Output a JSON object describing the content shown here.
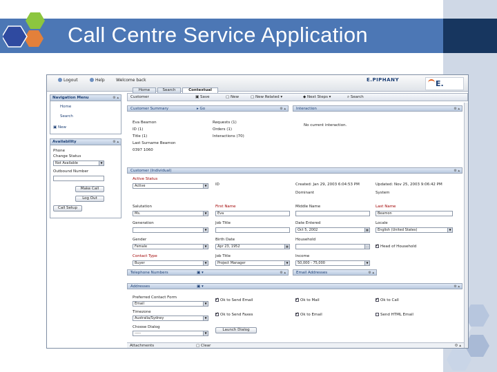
{
  "slide": {
    "title": "Call Centre Service Application",
    "colors": {
      "title_bar": "#4c77b5",
      "title_dark": "#17365f",
      "right_band": "#cfd8e6"
    }
  },
  "app": {
    "topbar": {
      "logout": "Logout",
      "help": "Help",
      "welcome": "Welcome back",
      "brand": "E.PIPHANY",
      "brand_logo": "E."
    },
    "tabs": [
      "Home",
      "Search",
      "Contextual"
    ],
    "nav_panel": {
      "title": "Navigation Menu",
      "items": [
        "Home",
        "Search"
      ],
      "new_label": "New"
    },
    "availability": {
      "title": "Availability",
      "phone_label": "Phone",
      "change_status_label": "Change Status",
      "status_value": "Not Available",
      "outbound_label": "Outbound Number",
      "make_call": "Make Call",
      "log_out": "Log Out",
      "call_setup": "Call Setup"
    },
    "toolbar": {
      "customer": "Customer",
      "save": "Save",
      "new": "New",
      "new_related": "New Related",
      "next_steps": "Next Steps",
      "search": "Search"
    },
    "summary": {
      "title": "Customer Summary",
      "left_lines": [
        "Eva Beamon",
        "ID (1)",
        "Title (1)",
        "Last Surname Beamon",
        "0397 1060"
      ],
      "right_lines": [
        "Requests (1)",
        "Orders (1)",
        "Interactions (70)"
      ]
    },
    "interaction": {
      "title": "Interaction",
      "text": "No current interaction."
    },
    "customer_detail": {
      "title": "Customer (Individual)",
      "active_status_label": "Active Status",
      "active_status_value": "Active",
      "id_label": "ID",
      "created": "Created: Jan 29, 2003 6:04:53 PM",
      "created_by": "Dominant",
      "updated": "Updated: Nov 25, 2003 9:06:42 PM",
      "updated_by": "System",
      "fields": {
        "salutation": {
          "label": "Salutation",
          "value": "Ms."
        },
        "first_name": {
          "label": "First Name",
          "value": "Eva"
        },
        "middle_name": {
          "label": "Middle Name",
          "value": ""
        },
        "last_name": {
          "label": "Last Name",
          "value": "Beamon"
        },
        "generation": {
          "label": "Generation",
          "value": ""
        },
        "job_title": {
          "label": "Job Title",
          "value": ""
        },
        "date_entered": {
          "label": "Date Entered",
          "value": "Oct 5, 2002"
        },
        "locale": {
          "label": "Locale",
          "value": "English (United States)"
        },
        "gender": {
          "label": "Gender",
          "value": "Female"
        },
        "birth_date": {
          "label": "Birth Date",
          "value": "Apr 23, 1952"
        },
        "household": {
          "label": "Household",
          "value": ""
        },
        "head_of_household": "Head of Household",
        "contact_type": {
          "label": "Contact Type",
          "value": "Buyer"
        },
        "job_title2": {
          "label": "Job Title",
          "value": "Project Manager"
        },
        "income": {
          "label": "Income",
          "value": "50,000 - 75,000"
        }
      }
    },
    "telephone": {
      "title": "Telephone Numbers"
    },
    "email": {
      "title": "Email Addresses"
    },
    "addresses": {
      "title": "Addresses",
      "preferred_contact_label": "Preferred Contact Form",
      "preferred_contact_value": "Email",
      "timezone_label": "Timezone",
      "timezone_value": "Australia/Sydney",
      "dialog_label": "Choose Dialog",
      "dialog_value": "-----",
      "launch_dialog": "Launch Dialog",
      "checks": [
        {
          "label": "Ok to Send Email",
          "checked": true
        },
        {
          "label": "Ok to Mail",
          "checked": true
        },
        {
          "label": "Ok to Call",
          "checked": true
        },
        {
          "label": "Ok to Send Faxes",
          "checked": true
        },
        {
          "label": "Ok to Email",
          "checked": true
        },
        {
          "label": "Send HTML Email",
          "checked": false
        }
      ]
    },
    "status_bar": {
      "left": "Attachments",
      "right": "Clear"
    }
  }
}
